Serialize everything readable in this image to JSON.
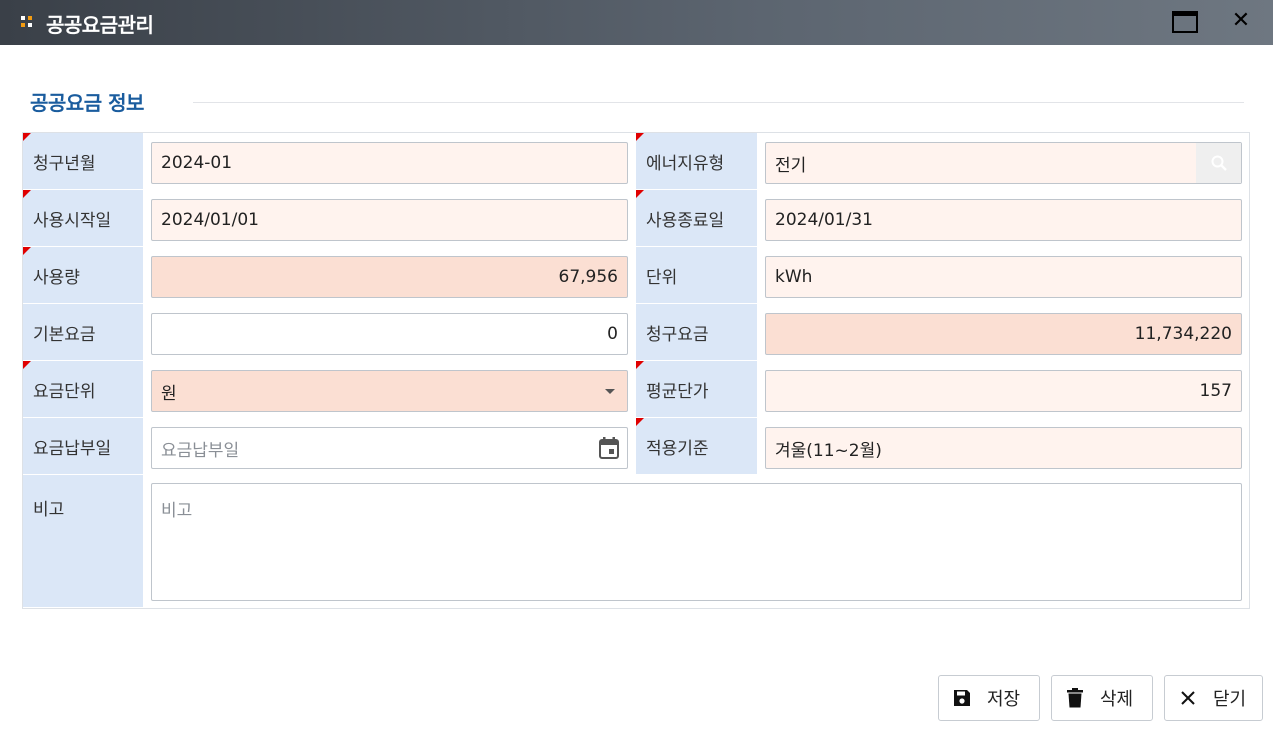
{
  "window": {
    "title": "공공요금관리",
    "close_glyph": "✕",
    "icons": [
      "grip-icon",
      "maximize-icon",
      "close-icon"
    ]
  },
  "section": {
    "title": "공공요금 정보"
  },
  "form": {
    "billing_month": {
      "label": "청구년월",
      "value": "2024-01"
    },
    "energy_type": {
      "label": "에너지유형",
      "value": "전기"
    },
    "start_date": {
      "label": "사용시작일",
      "value": "2024/01/01"
    },
    "end_date": {
      "label": "사용종료일",
      "value": "2024/01/31"
    },
    "usage": {
      "label": "사용량",
      "value": "67,956"
    },
    "unit": {
      "label": "단위",
      "value": "kWh"
    },
    "base_fee": {
      "label": "기본요금",
      "value": "0"
    },
    "billed_amount": {
      "label": "청구요금",
      "value": "11,734,220"
    },
    "fee_unit": {
      "label": "요금단위",
      "value": "원"
    },
    "avg_unit_price": {
      "label": "평균단가",
      "value": "157"
    },
    "payment_date": {
      "label": "요금납부일",
      "placeholder": "요금납부일"
    },
    "apply_basis": {
      "label": "적용기준",
      "value": "겨울(11~2월)"
    },
    "remarks": {
      "label": "비고",
      "placeholder": "비고"
    }
  },
  "buttons": {
    "save": "저장",
    "delete": "삭제",
    "close": "닫기"
  },
  "colors": {
    "titlebar": "#3a4048",
    "section_title": "#1a5c9e",
    "label_bg": "#dbe7f7",
    "required_field_bg": "#fff3ee",
    "computed_field_bg": "#fbdfd3",
    "required_marker": "#e00000"
  }
}
